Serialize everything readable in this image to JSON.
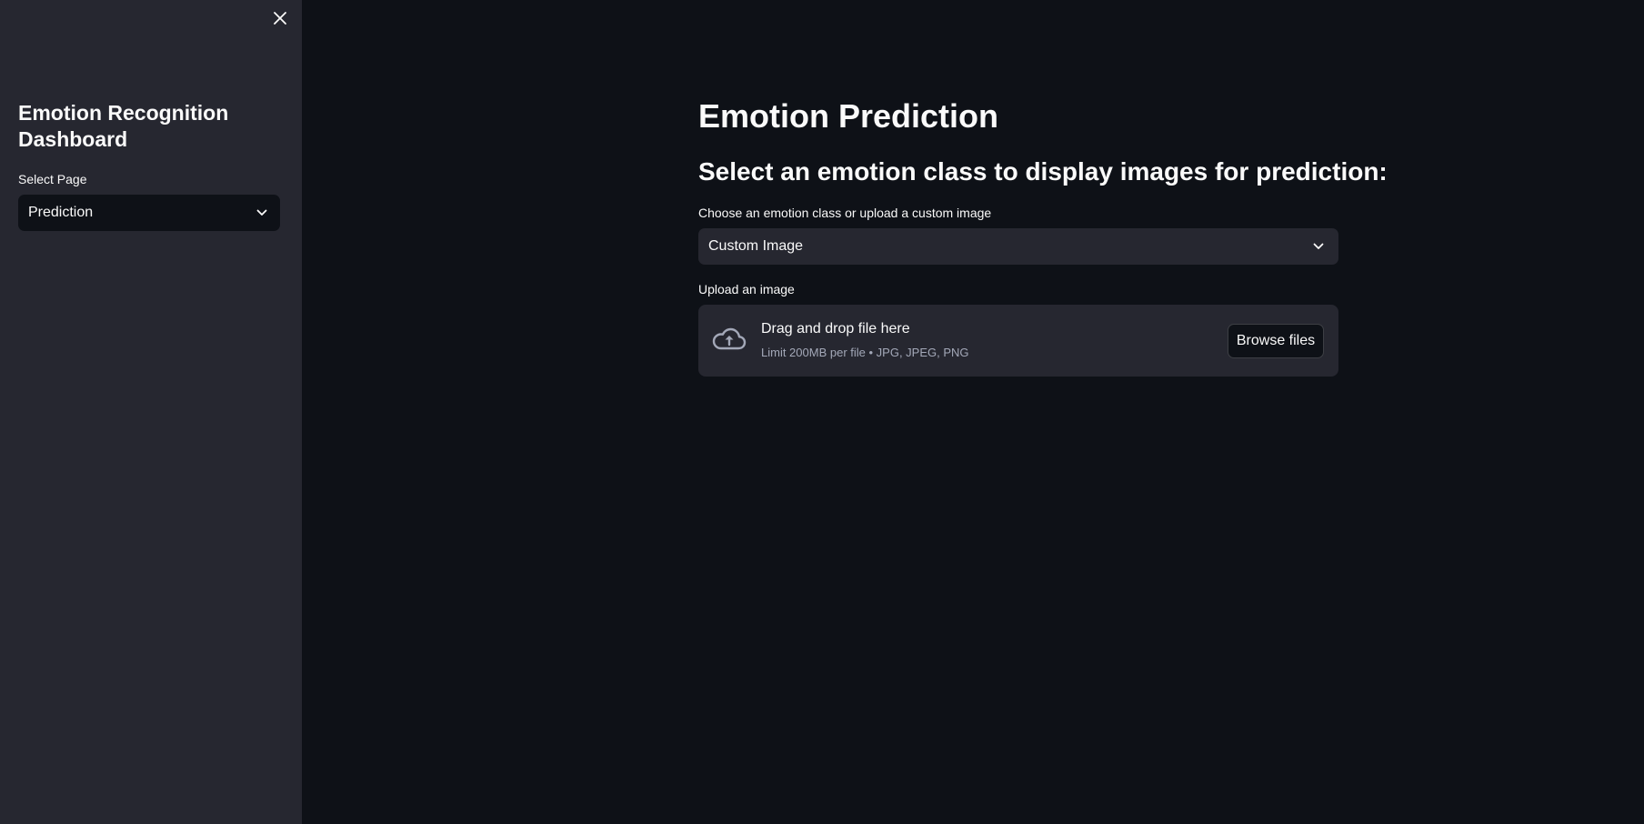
{
  "sidebar": {
    "title": "Emotion Recognition Dashboard",
    "select_label": "Select Page",
    "select_value": "Prediction",
    "close_icon": "close-icon"
  },
  "main": {
    "title": "Emotion Prediction",
    "subheader": "Select an emotion class to display images for prediction:",
    "class_select": {
      "label": "Choose an emotion class or upload a custom image",
      "value": "Custom Image"
    },
    "uploader": {
      "label": "Upload an image",
      "drop_text": "Drag and drop file here",
      "limit_text": "Limit 200MB per file • JPG, JPEG, PNG",
      "button_label": "Browse files",
      "icon": "cloud-upload-icon"
    }
  },
  "colors": {
    "background": "#0e1117",
    "sidebar_background": "#262730",
    "text": "#fafafa",
    "muted_text": "#a3a8b8"
  }
}
